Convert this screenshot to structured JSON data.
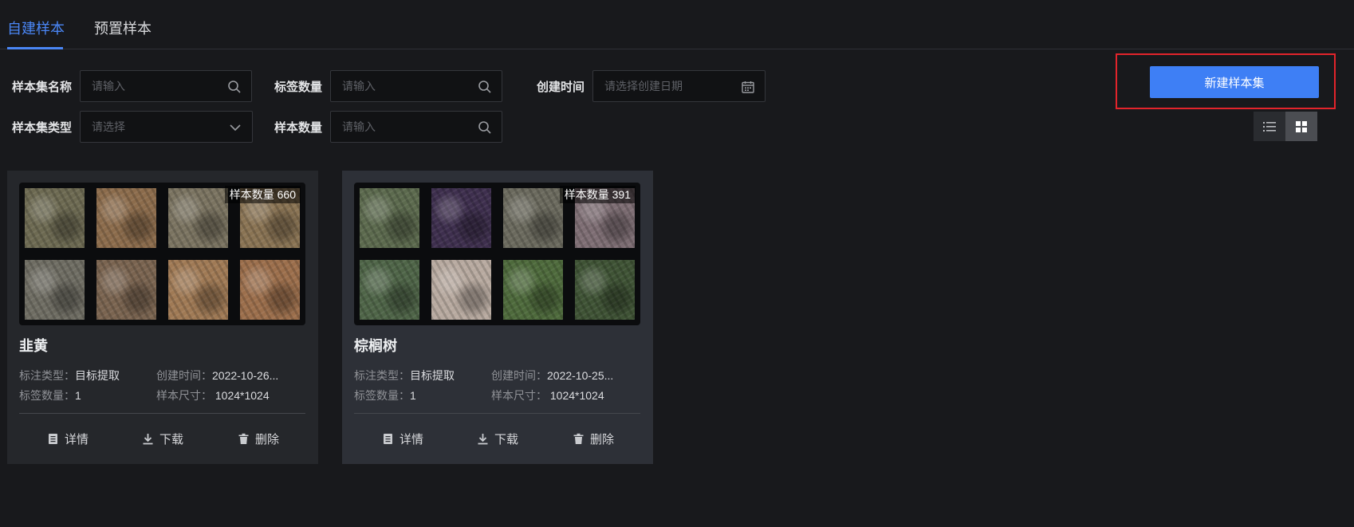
{
  "tabs": [
    {
      "label": "自建样本",
      "active": true
    },
    {
      "label": "预置样本",
      "active": false
    }
  ],
  "filters": {
    "name": {
      "label": "样本集名称",
      "placeholder": "请输入"
    },
    "label_count": {
      "label": "标签数量",
      "placeholder": "请输入"
    },
    "created": {
      "label": "创建时间",
      "placeholder": "请选择创建日期"
    },
    "type": {
      "label": "样本集类型",
      "placeholder": "请选择"
    },
    "sample_count": {
      "label": "样本数量",
      "placeholder": "请输入"
    }
  },
  "actions": {
    "new_set": "新建样本集"
  },
  "view_modes": {
    "list": "list-view-icon",
    "grid": "grid-view-icon",
    "active": "grid"
  },
  "cards": [
    {
      "title": "韭黄",
      "badge": "样本数量 660",
      "annotation_type_label": "标注类型：",
      "annotation_type": "目标提取",
      "created_label": "创建时间：",
      "created": "2022-10-26...",
      "label_count_label": "标签数量：",
      "label_count": "1",
      "size_label": "样本尺寸：",
      "size": "1024*1024",
      "detail": "详情",
      "download": "下载",
      "delete": "删除",
      "thumb_colors": [
        "#6d6a52",
        "#8c6c4c",
        "#7b7461",
        "#8a7454",
        "#6f6d63",
        "#7a6450",
        "#a07a55",
        "#9c6f4c"
      ]
    },
    {
      "title": "棕榈树",
      "badge": "样本数量 391",
      "annotation_type_label": "标注类型：",
      "annotation_type": "目标提取",
      "created_label": "创建时间：",
      "created": "2022-10-25...",
      "label_count_label": "标签数量：",
      "label_count": "1",
      "size_label": "样本尺寸：",
      "size": "1024*1024",
      "detail": "详情",
      "download": "下载",
      "delete": "删除",
      "thumb_colors": [
        "#5c6a4e",
        "#3e2f4e",
        "#6b6a5e",
        "#7e6e74",
        "#4f6548",
        "#b8aaa0",
        "#4e6a3c",
        "#3f5335"
      ]
    }
  ],
  "colors": {
    "accent": "#3e7ff5",
    "highlight": "#e3242b",
    "background": "#18191c"
  }
}
